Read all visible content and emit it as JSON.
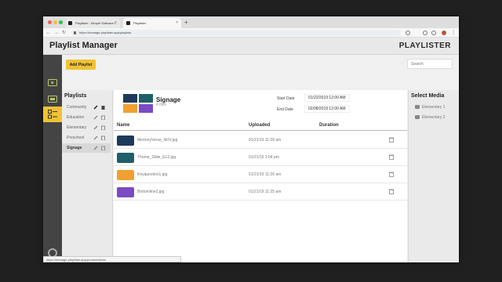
{
  "browser": {
    "tabs": [
      {
        "title": "Playlister - Simple Software f..."
      },
      {
        "title": "Playlister"
      }
    ],
    "new_tab": "+",
    "url": "https://manage.playlister.app/playlists",
    "status_url": "https://manage.playlister.app/presentations"
  },
  "app": {
    "title": "Playlist Manager",
    "logo": "PLAYLISTER",
    "add_button": "Add Playlist",
    "search_placeholder": "Search"
  },
  "playlists": {
    "heading": "Playlists",
    "items": [
      {
        "label": "Community"
      },
      {
        "label": "Education"
      },
      {
        "label": "Elementary"
      },
      {
        "label": "Preschool"
      },
      {
        "label": "Signage"
      }
    ],
    "selected": "Signage"
  },
  "detail": {
    "name": "Signage",
    "file_count": "4 files",
    "start_date_label": "Start Date",
    "start_date": "01/22/2019 12:00 AM",
    "end_date_label": "End Date",
    "end_date": "02/08/2019 12:00 AM",
    "columns": {
      "name": "Name",
      "uploaded": "Uploaded",
      "duration": "Duration"
    },
    "rows": [
      {
        "name": "MemoryVerse_NIrV.jpg",
        "uploaded": "01/21/19 11:28 am",
        "thumb_color": "#1e3a5a"
      },
      {
        "name": "Theme_Slide_EL2.jpg",
        "uploaded": "01/21/19 1:04 pm",
        "thumb_color": "#1f5f6a"
      },
      {
        "name": "Keyquestion1.jpg",
        "uploaded": "01/21/19 11:26 am",
        "thumb_color": "#f0a030"
      },
      {
        "name": "Bottomline2.jpg",
        "uploaded": "01/21/19 11:25 am",
        "thumb_color": "#7a4bc4"
      }
    ]
  },
  "media": {
    "heading": "Select Media",
    "folders": [
      {
        "label": "Elementary 1"
      },
      {
        "label": "Elementary 2"
      }
    ]
  },
  "colors": {
    "accent": "#f0c235",
    "rail": "#444444"
  }
}
